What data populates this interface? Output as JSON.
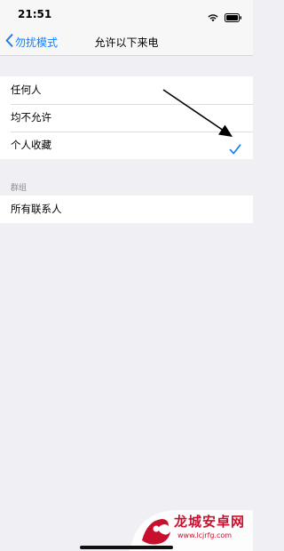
{
  "status_bar": {
    "time": "21:51",
    "icons": [
      "wifi-icon",
      "battery-icon"
    ]
  },
  "nav": {
    "back_label": "勿扰模式",
    "title": "允许以下来电"
  },
  "options": [
    {
      "label": "任何人",
      "selected": false
    },
    {
      "label": "均不允许",
      "selected": false
    },
    {
      "label": "个人收藏",
      "selected": true
    }
  ],
  "groups_section": {
    "header": "群组",
    "items": [
      {
        "label": "所有联系人"
      }
    ]
  },
  "colors": {
    "accent": "#147efb",
    "background": "#efeff4",
    "watermark": "#c8102e"
  },
  "watermark": {
    "brand": "龙城安卓网",
    "url": "www.lcjrfg.com"
  }
}
